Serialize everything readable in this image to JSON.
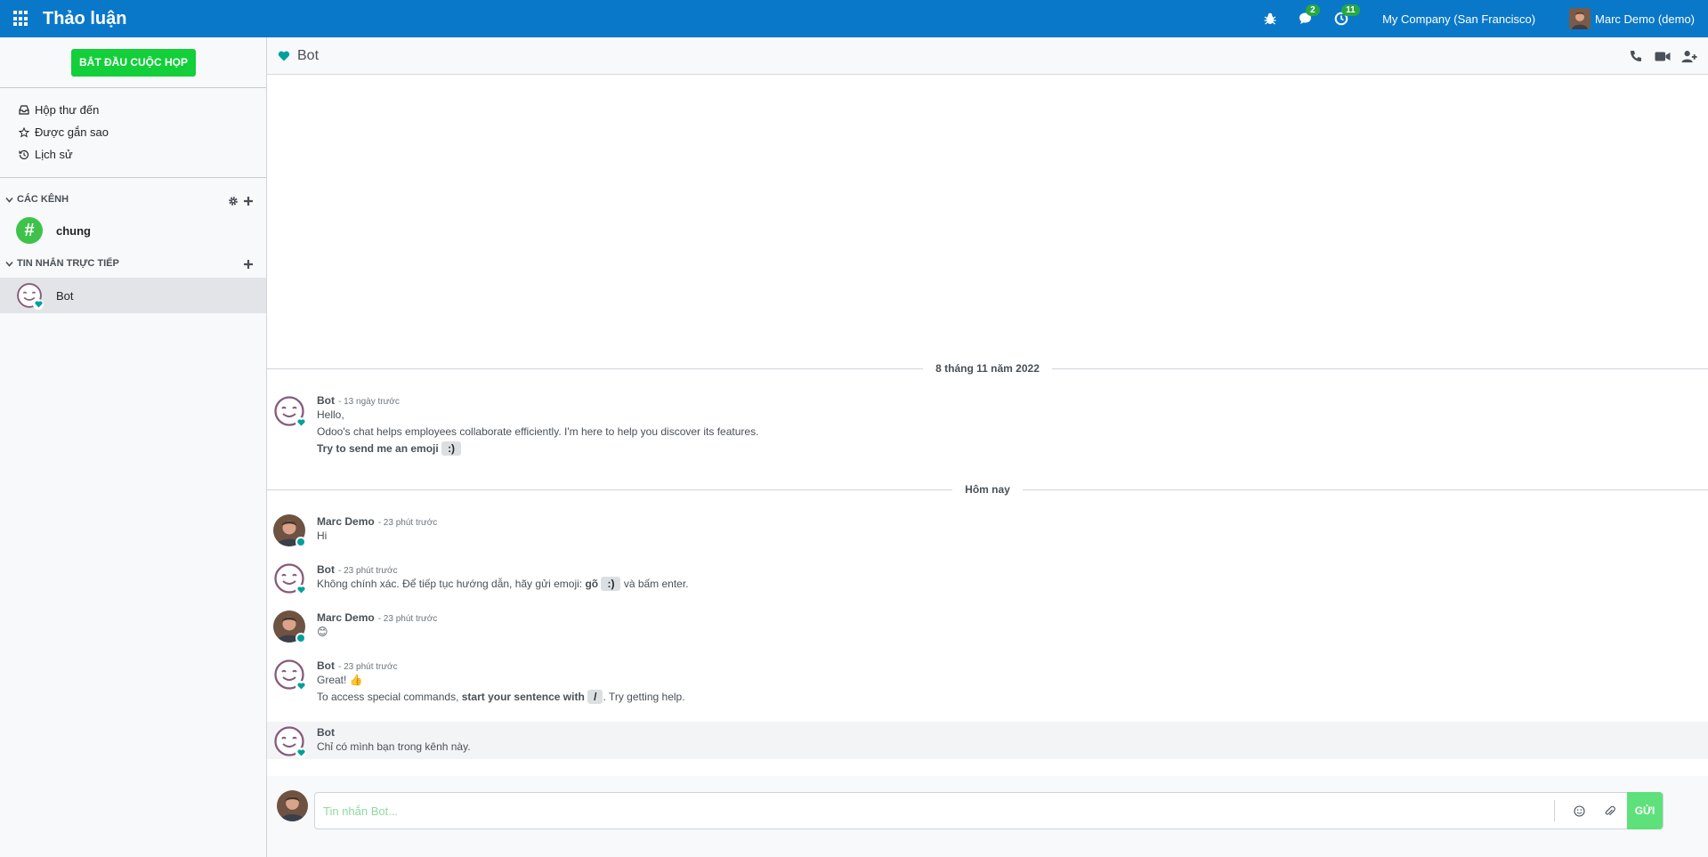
{
  "topbar": {
    "app_title": "Thảo luận",
    "messages_badge": "2",
    "activities_badge": "11",
    "company": "My Company (San Francisco)",
    "user_name": "Marc Demo (demo)"
  },
  "sidebar": {
    "start_meeting": "BẮT ĐẦU CUỘC HỌP",
    "mailboxes": [
      {
        "label": "Hộp thư đến",
        "icon": "inbox-icon"
      },
      {
        "label": "Được gắn sao",
        "icon": "star-icon"
      },
      {
        "label": "Lịch sử",
        "icon": "history-icon"
      }
    ],
    "channels_header": "CÁC KÊNH",
    "channels": [
      {
        "label": "chung"
      }
    ],
    "dm_header": "TIN NHẮN TRỰC TIẾP",
    "direct_messages": [
      {
        "label": "Bot"
      }
    ]
  },
  "thread": {
    "title": "Bot",
    "separators": [
      "8 tháng 11 năm 2022",
      "Hôm nay"
    ],
    "messages": [
      {
        "author": "Bot",
        "date": "- 13 ngày trước",
        "lines": [
          "Hello,",
          "Odoo's chat helps employees collaborate efficiently. I'm here to help you discover its features."
        ],
        "bold_line": "Try to send me an emoji",
        "kbd": ":)"
      },
      {
        "author": "Marc Demo",
        "date": "- 23 phút trước",
        "text": "Hi"
      },
      {
        "author": "Bot",
        "date": "- 23 phút trước",
        "text_before": "Không chính xác. Để tiếp tục hướng dẫn, hãy gửi emoji:",
        "bold": "gõ",
        "kbd": ":)",
        "text_after": "và bấm enter."
      },
      {
        "author": "Marc Demo",
        "date": "- 23 phút trước",
        "emoji": "😊"
      },
      {
        "author": "Bot",
        "date": "- 23 phút trước",
        "line1": "Great!",
        "line1_emoji": "👍",
        "line2_before": "To access special commands,",
        "line2_bold": "start your sentence with",
        "kbd": "/",
        "line2_after": ". Try getting help."
      },
      {
        "author": "Bot",
        "text": "Chỉ có mình bạn trong kênh này."
      }
    ]
  },
  "composer": {
    "placeholder": "Tin nhắn Bot...",
    "send_label": "GỬI"
  },
  "colors": {
    "topbar": "#0a78c8",
    "start_meeting": "#13cf3a",
    "send": "#5ee17a",
    "online": "#00a09d"
  }
}
